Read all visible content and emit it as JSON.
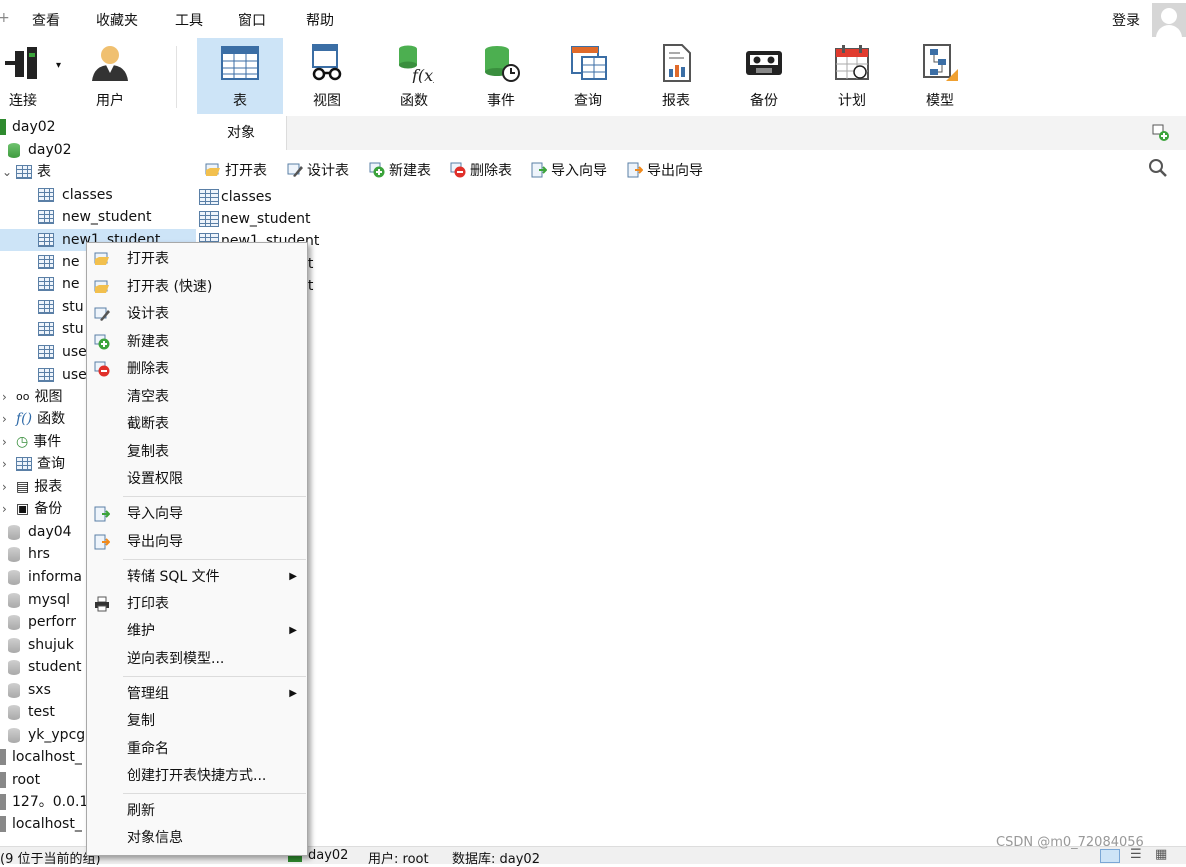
{
  "menubar": {
    "items": [
      "查看",
      "收藏夹",
      "工具",
      "窗口",
      "帮助"
    ],
    "login": "登录"
  },
  "toolbar": {
    "items": [
      {
        "label": "连接",
        "icon": "plug-icon"
      },
      {
        "label": "用户",
        "icon": "user-icon"
      },
      {
        "label": "表",
        "icon": "table-icon"
      },
      {
        "label": "视图",
        "icon": "view-glasses-icon"
      },
      {
        "label": "函数",
        "icon": "function-icon"
      },
      {
        "label": "事件",
        "icon": "event-clock-icon"
      },
      {
        "label": "查询",
        "icon": "query-icon"
      },
      {
        "label": "报表",
        "icon": "report-icon"
      },
      {
        "label": "备份",
        "icon": "backup-tape-icon"
      },
      {
        "label": "计划",
        "icon": "calendar-icon"
      },
      {
        "label": "模型",
        "icon": "model-icon"
      }
    ],
    "active": "表"
  },
  "tree": {
    "connection": "day02",
    "database": "day02",
    "tables_node": "表",
    "tables": [
      "classes",
      "new_student",
      "new1_student",
      "ne",
      "ne",
      "stu",
      "stu",
      "use",
      "use"
    ],
    "other_nodes": [
      "视图",
      "函数",
      "事件",
      "查询",
      "报表",
      "备份"
    ],
    "databases": [
      "day04",
      "hrs",
      "informa",
      "mysql",
      "perforr",
      "shujuk",
      "student",
      "sxs",
      "test",
      "yk_ypcg"
    ],
    "connections": [
      "localhost_",
      "root",
      "127。0.0.1",
      "localhost_"
    ]
  },
  "panel": {
    "tab": "对象",
    "actions": [
      "打开表",
      "设计表",
      "新建表",
      "删除表",
      "导入向导",
      "导出向导"
    ],
    "objects": [
      "classes",
      "new_student",
      "new1_student",
      "nt",
      "nt"
    ]
  },
  "context_menu": {
    "groups": [
      [
        {
          "label": "打开表",
          "icon": "open-table-icon"
        },
        {
          "label": "打开表 (快速)",
          "icon": "open-table-icon"
        },
        {
          "label": "设计表",
          "icon": "design-table-icon"
        },
        {
          "label": "新建表",
          "icon": "new-table-icon"
        },
        {
          "label": "删除表",
          "icon": "delete-table-icon"
        },
        {
          "label": "清空表"
        },
        {
          "label": "截断表"
        },
        {
          "label": "复制表"
        },
        {
          "label": "设置权限"
        }
      ],
      [
        {
          "label": "导入向导",
          "icon": "import-wizard-icon"
        },
        {
          "label": "导出向导",
          "icon": "export-wizard-icon"
        }
      ],
      [
        {
          "label": "转储 SQL 文件",
          "submenu": true
        },
        {
          "label": "打印表",
          "icon": "printer-icon"
        },
        {
          "label": "维护",
          "submenu": true
        },
        {
          "label": "逆向表到模型..."
        }
      ],
      [
        {
          "label": "管理组",
          "submenu": true
        },
        {
          "label": "复制"
        },
        {
          "label": "重命名"
        },
        {
          "label": "创建打开表快捷方式..."
        }
      ],
      [
        {
          "label": "刷新"
        },
        {
          "label": "对象信息"
        }
      ]
    ]
  },
  "statusbar": {
    "left": "(9 位于当前的组)",
    "connection": "day02",
    "user": "用户: root",
    "database": "数据库: day02"
  },
  "watermark": "CSDN @m0_72084056"
}
